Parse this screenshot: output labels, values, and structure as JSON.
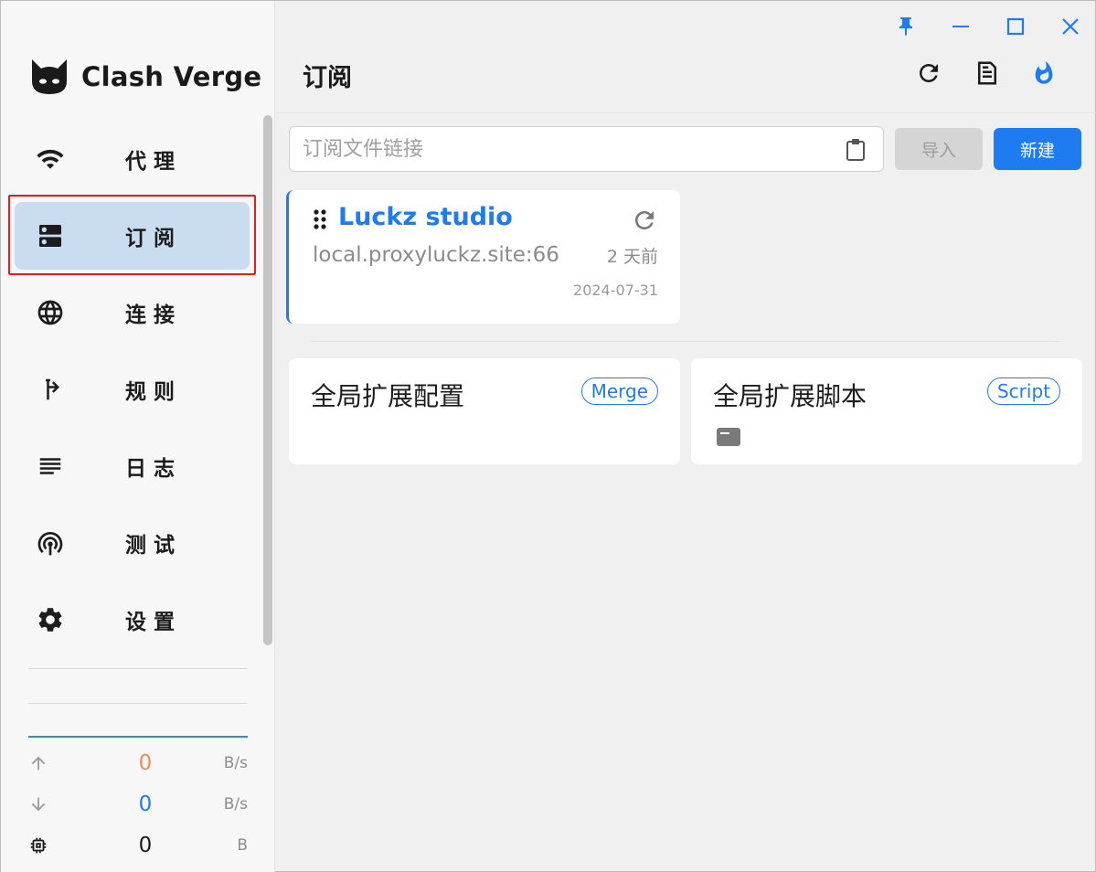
{
  "app": {
    "name": "Clash Verge"
  },
  "sidebar": {
    "items": [
      {
        "label": "代理",
        "icon": "wifi-icon",
        "active": false
      },
      {
        "label": "订阅",
        "icon": "dns-icon",
        "active": true
      },
      {
        "label": "连接",
        "icon": "globe-icon",
        "active": false
      },
      {
        "label": "规则",
        "icon": "fork-icon",
        "active": false
      },
      {
        "label": "日志",
        "icon": "list-icon",
        "active": false
      },
      {
        "label": "测试",
        "icon": "radar-icon",
        "active": false
      },
      {
        "label": "设置",
        "icon": "gear-icon",
        "active": false
      }
    ],
    "traffic": {
      "upload": {
        "value": "0",
        "unit": "B/s",
        "color": "#f08a5d"
      },
      "download": {
        "value": "0",
        "unit": "B/s",
        "color": "#1e7bf0"
      },
      "memory": {
        "value": "0",
        "unit": "B",
        "color": "#1c1c1c"
      }
    }
  },
  "header": {
    "title": "订阅"
  },
  "import_bar": {
    "placeholder": "订阅文件链接",
    "import_label": "导入",
    "new_label": "新建"
  },
  "profile": {
    "name": "Luckz studio",
    "host": "local.proxyluckz.site:66",
    "updated_ago": "2 天前",
    "date": "2024-07-31"
  },
  "extensions": [
    {
      "title": "全局扩展配置",
      "tag": "Merge"
    },
    {
      "title": "全局扩展脚本",
      "tag": "Script"
    }
  ],
  "colors": {
    "accent": "#1e7bf0",
    "active_bg": "#cadcf0",
    "highlight": "#e02020"
  }
}
